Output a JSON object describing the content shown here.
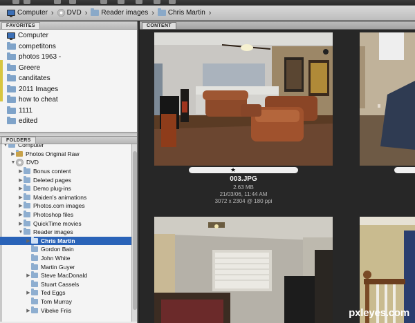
{
  "breadcrumb": [
    "Computer",
    "DVD",
    "Reader images",
    "Chris Martin"
  ],
  "favorites": {
    "tab_label": "FAVORITES",
    "items": [
      "Computer",
      "competitons",
      "photos 1963 -",
      "Greere",
      "canditates",
      "2011 Images",
      "how to cheat",
      "1111",
      "edited"
    ]
  },
  "folders": {
    "tab_label": "FOLDERS",
    "rows": [
      {
        "label": "Computer",
        "level": 0
      },
      {
        "label": "Photos Original Raw",
        "level": 1
      },
      {
        "label": "DVD",
        "level": 1
      },
      {
        "label": "Bonus content",
        "level": 2
      },
      {
        "label": "Deleted pages",
        "level": 2
      },
      {
        "label": "Demo plug-ins",
        "level": 2
      },
      {
        "label": "Maiden's animations",
        "level": 2
      },
      {
        "label": "Photos.com images",
        "level": 2
      },
      {
        "label": "Photoshop files",
        "level": 2
      },
      {
        "label": "QuickTime movies",
        "level": 2
      },
      {
        "label": "Reader images",
        "level": 2
      },
      {
        "label": "Chris Martin",
        "level": 3,
        "selected": true
      },
      {
        "label": "Gordon Bain",
        "level": 3
      },
      {
        "label": "John White",
        "level": 3
      },
      {
        "label": "Martin Guyer",
        "level": 3
      },
      {
        "label": "Steve MacDonald",
        "level": 3
      },
      {
        "label": "Stuart Cassels",
        "level": 3
      },
      {
        "label": "Ted Eggs",
        "level": 3
      },
      {
        "label": "Tom Murray",
        "level": 3
      },
      {
        "label": "Vibeke Friis",
        "level": 3
      }
    ]
  },
  "content": {
    "tab_label": "CONTENT",
    "selected_file": {
      "rating_star": "★",
      "name": "003.JPG",
      "size": "2.63 MB",
      "date": "21/03/06, 11:44 AM",
      "dimensions": "3072 x 2304 @ 180 ppi"
    }
  },
  "watermark": "pxleyes.com",
  "colors": {
    "selection": "#2a63b8",
    "content_bg": "#272727",
    "folder_icon": "#8eaed0"
  }
}
